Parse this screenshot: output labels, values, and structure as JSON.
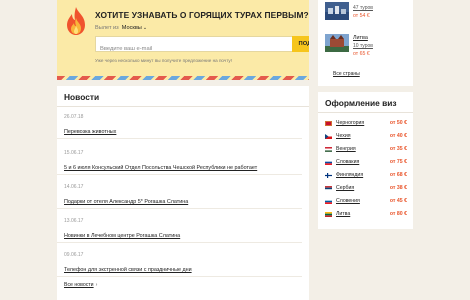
{
  "subscribe": {
    "title": "ХОТИТЕ УЗНАВАТЬ О ГОРЯЩИХ ТУРАХ ПЕРВЫМ?",
    "city_label": "Вылет из",
    "city_value": "Москвы",
    "email_placeholder": "Введите ваш e-mail",
    "button_label": "ПОДПИСАТЬСЯ",
    "note": "Уже через несколько минут вы получите предложение на почту!"
  },
  "news": {
    "title": "Новости",
    "items": [
      {
        "date": "26.07.18",
        "text": "Перевозка животных"
      },
      {
        "date": "15.06.17",
        "text": "5 и 6 июля Консульский Отдел Посольства Чешской Республики не работает"
      },
      {
        "date": "14.06.17",
        "text": "Подарки от отеля Александр 5* Рогашка Слатина"
      },
      {
        "date": "13.06.17",
        "text": "Новинки в Лечебном центре Рогашка Слатина"
      },
      {
        "date": "09.06.17",
        "text": "Телефон для экстренной связи с праздничные дни"
      }
    ],
    "all_label": "Все новости",
    "all_arrow": "›"
  },
  "tours": {
    "items": [
      {
        "count": "47 туров",
        "price": "от 54 €"
      },
      {
        "name": "Литва",
        "count": "10 туров",
        "price": "от 65 €"
      }
    ],
    "all_label": "Все страны"
  },
  "visa": {
    "title": "Оформление виз",
    "rows": [
      {
        "country": "Черногория",
        "price": "от 50 €"
      },
      {
        "country": "Чехия",
        "price": "от 40 €"
      },
      {
        "country": "Венгрия",
        "price": "от 35 €"
      },
      {
        "country": "Словакия",
        "price": "от 75 €"
      },
      {
        "country": "Финляндия",
        "price": "от 68 €"
      },
      {
        "country": "Сербия",
        "price": "от 38 €"
      },
      {
        "country": "Словения",
        "price": "от 45 €"
      },
      {
        "country": "Литва",
        "price": "от 80 €"
      }
    ]
  },
  "colors": {
    "accent_price": "#e9542a",
    "button": "#f6c51c",
    "banner": "#fbeaa7"
  },
  "icons": [
    "flame-icon",
    "chevron-down-icon",
    "arrow-right-icon",
    "flag-icon"
  ]
}
